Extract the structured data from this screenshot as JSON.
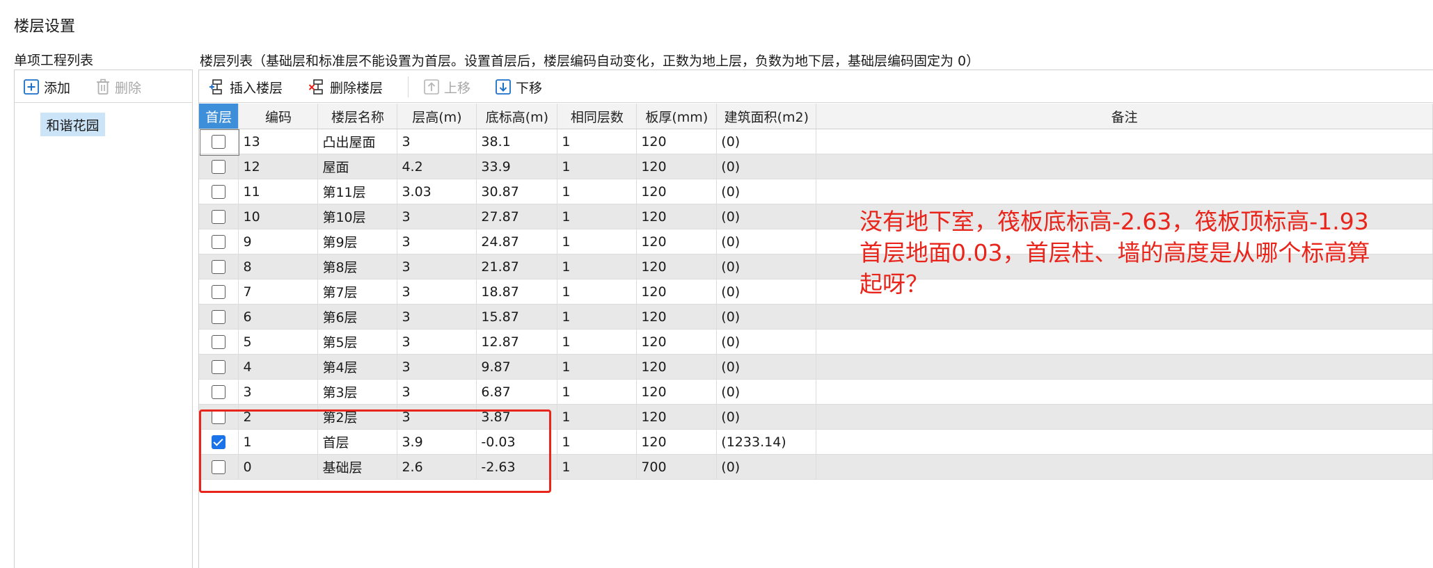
{
  "window": {
    "title": "楼层设置"
  },
  "left_pane": {
    "label": "单项工程列表",
    "toolbar": {
      "add_label": "添加",
      "delete_label": "删除"
    },
    "projects": [
      "和谐花园"
    ]
  },
  "right_pane": {
    "label": "楼层列表（基础层和标准层不能设置为首层。设置首层后，楼层编码自动变化，正数为地上层，负数为地下层，基础层编码固定为 0）",
    "toolbar": {
      "insert_label": "插入楼层",
      "delete_label": "删除楼层",
      "move_up_label": "上移",
      "move_down_label": "下移"
    },
    "table": {
      "headers": [
        "首层",
        "编码",
        "楼层名称",
        "层高(m)",
        "底标高(m)",
        "相同层数",
        "板厚(mm)",
        "建筑面积(m2)",
        "备注"
      ],
      "rows": [
        {
          "first": false,
          "code": "13",
          "name": "凸出屋面",
          "height": "3",
          "bottom": "38.1",
          "same": "1",
          "slab": "120",
          "area": "(0)",
          "note": ""
        },
        {
          "first": false,
          "code": "12",
          "name": "屋面",
          "height": "4.2",
          "bottom": "33.9",
          "same": "1",
          "slab": "120",
          "area": "(0)",
          "note": ""
        },
        {
          "first": false,
          "code": "11",
          "name": "第11层",
          "height": "3.03",
          "bottom": "30.87",
          "same": "1",
          "slab": "120",
          "area": "(0)",
          "note": ""
        },
        {
          "first": false,
          "code": "10",
          "name": "第10层",
          "height": "3",
          "bottom": "27.87",
          "same": "1",
          "slab": "120",
          "area": "(0)",
          "note": ""
        },
        {
          "first": false,
          "code": "9",
          "name": "第9层",
          "height": "3",
          "bottom": "24.87",
          "same": "1",
          "slab": "120",
          "area": "(0)",
          "note": ""
        },
        {
          "first": false,
          "code": "8",
          "name": "第8层",
          "height": "3",
          "bottom": "21.87",
          "same": "1",
          "slab": "120",
          "area": "(0)",
          "note": ""
        },
        {
          "first": false,
          "code": "7",
          "name": "第7层",
          "height": "3",
          "bottom": "18.87",
          "same": "1",
          "slab": "120",
          "area": "(0)",
          "note": ""
        },
        {
          "first": false,
          "code": "6",
          "name": "第6层",
          "height": "3",
          "bottom": "15.87",
          "same": "1",
          "slab": "120",
          "area": "(0)",
          "note": ""
        },
        {
          "first": false,
          "code": "5",
          "name": "第5层",
          "height": "3",
          "bottom": "12.87",
          "same": "1",
          "slab": "120",
          "area": "(0)",
          "note": ""
        },
        {
          "first": false,
          "code": "4",
          "name": "第4层",
          "height": "3",
          "bottom": "9.87",
          "same": "1",
          "slab": "120",
          "area": "(0)",
          "note": ""
        },
        {
          "first": false,
          "code": "3",
          "name": "第3层",
          "height": "3",
          "bottom": "6.87",
          "same": "1",
          "slab": "120",
          "area": "(0)",
          "note": ""
        },
        {
          "first": false,
          "code": "2",
          "name": "第2层",
          "height": "3",
          "bottom": "3.87",
          "same": "1",
          "slab": "120",
          "area": "(0)",
          "note": ""
        },
        {
          "first": true,
          "code": "1",
          "name": "首层",
          "height": "3.9",
          "bottom": "-0.03",
          "same": "1",
          "slab": "120",
          "area": "(1233.14)",
          "note": ""
        },
        {
          "first": false,
          "code": "0",
          "name": "基础层",
          "height": "2.6",
          "bottom": "-2.63",
          "same": "1",
          "slab": "700",
          "area": "(0)",
          "note": ""
        }
      ]
    }
  },
  "annotation": {
    "text": "没有地下室，筏板底标高-2.63，筏板顶标高-1.93\n首层地面0.03，首层柱、墙的高度是从哪个标高算\n起呀？",
    "color": "#e8241b"
  },
  "colors": {
    "accent": "#3d8fd9",
    "selection": "#cce4f7",
    "checkbox_checked": "#1a73e8",
    "annotation": "#e8241b"
  },
  "icons": {
    "add": "plus-box-icon",
    "delete": "trash-icon",
    "insert_floor": "insert-floor-icon",
    "delete_floor": "delete-floor-icon",
    "move_up": "arrow-up-box-icon",
    "move_down": "arrow-down-box-icon"
  }
}
